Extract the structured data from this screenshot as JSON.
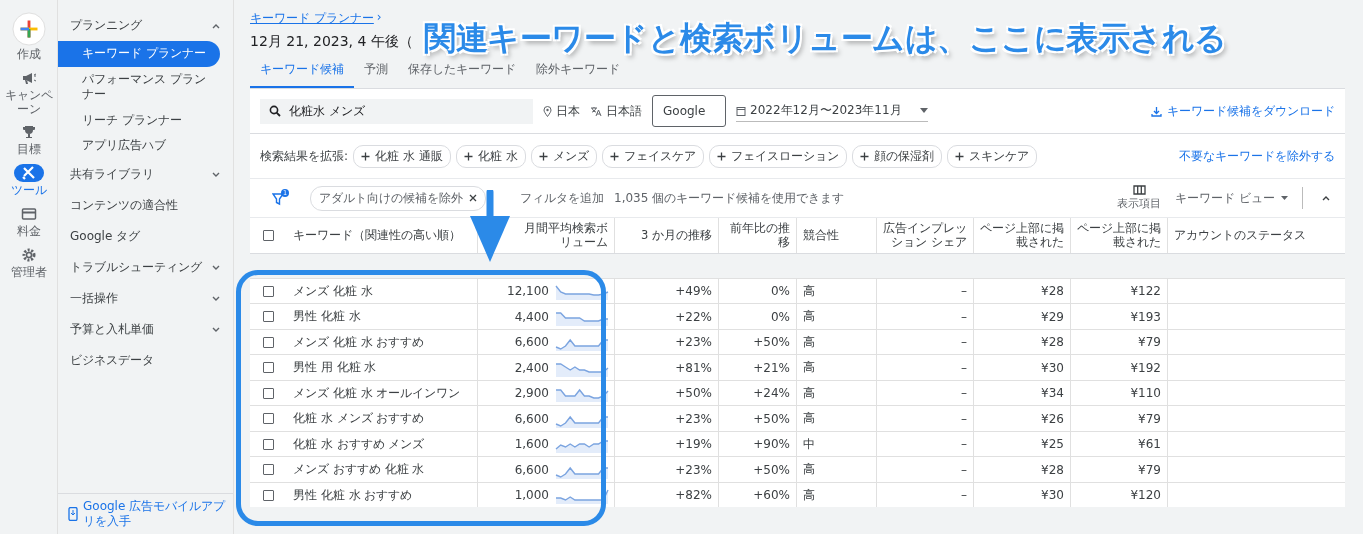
{
  "rail": [
    {
      "kind": "create",
      "label": "作成",
      "selected": false
    },
    {
      "kind": "campaign",
      "label": "キャンペーン",
      "selected": false
    },
    {
      "kind": "goal",
      "label": "目標",
      "selected": false
    },
    {
      "kind": "tools",
      "label": "ツール",
      "selected": true
    },
    {
      "kind": "billing",
      "label": "料金",
      "selected": false
    },
    {
      "kind": "admin",
      "label": "管理者",
      "selected": false
    }
  ],
  "nav": {
    "items": [
      {
        "kind": "group",
        "label": "プランニング",
        "expanded": true,
        "children": [
          {
            "label": "キーワード プランナー",
            "selected": true
          },
          {
            "label": "パフォーマンス プランナー",
            "selected": false
          },
          {
            "label": "リーチ プランナー",
            "selected": false
          },
          {
            "label": "アプリ広告ハブ",
            "selected": false
          }
        ]
      },
      {
        "kind": "group",
        "label": "共有ライブラリ",
        "expanded": false
      },
      {
        "kind": "link",
        "label": "コンテンツの適合性"
      },
      {
        "kind": "link",
        "label": "Google タグ"
      },
      {
        "kind": "group",
        "label": "トラブルシューティング",
        "expanded": false
      },
      {
        "kind": "group",
        "label": "一括操作",
        "expanded": false
      },
      {
        "kind": "group",
        "label": "予算と入札単価",
        "expanded": false
      },
      {
        "kind": "link",
        "label": "ビジネスデータ"
      }
    ],
    "footer": "Google 広告モバイルアプリを入手"
  },
  "breadcrumb": "キーワード プランナー",
  "breadcrumb_separator": "›",
  "title": "12月 21, 2023, 4 午後（",
  "tabs": [
    {
      "label": "キーワード候補",
      "selected": true
    },
    {
      "label": "予測",
      "selected": false
    },
    {
      "label": "保存したキーワード",
      "selected": false
    },
    {
      "label": "除外キーワード",
      "selected": false
    }
  ],
  "search": {
    "value": "化粧水 メンズ",
    "location": "日本",
    "language": "日本語",
    "network": "Google",
    "date_range": "2022年12月〜2023年11月",
    "download": "キーワード候補をダウンロード"
  },
  "expand": {
    "label": "検索結果を拡張:",
    "chips": [
      "化粧 水 通販",
      "化粧 水",
      "メンズ",
      "フェイスケア",
      "フェイスローション",
      "顔の保湿剤",
      "スキンケア"
    ],
    "exclude": "不要なキーワードを除外する"
  },
  "filters": {
    "badge": "1",
    "chip": "アダルト向けの候補を除外",
    "add": "フィルタを追加",
    "count": "1,035 個のキーワード候補を使用できます",
    "columns": "表示項目",
    "view": "キーワード ビュー"
  },
  "table": {
    "select_all_checked": false,
    "columns": [
      "キーワード（関連性の高い順）",
      "月間平均検索ボリューム",
      "3 か月の推移",
      "前年比の推移",
      "競合性",
      "広告インプレッション シェア",
      "ページ上部に掲載された",
      "ページ上部に掲載された",
      "アカウントのステータス"
    ],
    "rows": [
      {
        "checked": false,
        "cells": [
          "メンズ 化粧 水",
          "12,100",
          "+49%",
          "0%",
          "高",
          "–",
          "¥28",
          "¥122",
          ""
        ]
      },
      {
        "checked": false,
        "cells": [
          "男性 化粧 水",
          "4,400",
          "+22%",
          "0%",
          "高",
          "–",
          "¥29",
          "¥193",
          ""
        ]
      },
      {
        "checked": false,
        "cells": [
          "メンズ 化粧 水 おすすめ",
          "6,600",
          "+23%",
          "+50%",
          "高",
          "–",
          "¥28",
          "¥79",
          ""
        ]
      },
      {
        "checked": false,
        "cells": [
          "男性 用 化粧 水",
          "2,400",
          "+81%",
          "+21%",
          "高",
          "–",
          "¥30",
          "¥192",
          ""
        ]
      },
      {
        "checked": false,
        "cells": [
          "メンズ 化粧 水 オールインワン",
          "2,900",
          "+50%",
          "+24%",
          "高",
          "–",
          "¥34",
          "¥110",
          ""
        ]
      },
      {
        "checked": false,
        "cells": [
          "化粧 水 メンズ おすすめ",
          "6,600",
          "+23%",
          "+50%",
          "高",
          "–",
          "¥26",
          "¥79",
          ""
        ]
      },
      {
        "checked": false,
        "cells": [
          "化粧 水 おすすめ メンズ",
          "1,600",
          "+19%",
          "+90%",
          "中",
          "–",
          "¥25",
          "¥61",
          ""
        ]
      },
      {
        "checked": false,
        "cells": [
          "メンズ おすすめ 化粧 水",
          "6,600",
          "+23%",
          "+50%",
          "高",
          "–",
          "¥28",
          "¥79",
          ""
        ]
      },
      {
        "checked": false,
        "cells": [
          "男性 化粧 水 おすすめ",
          "1,000",
          "+82%",
          "+60%",
          "高",
          "–",
          "¥30",
          "¥120",
          ""
        ]
      }
    ]
  },
  "annotation": {
    "text": "関連キーワードと検索ボリュームは、ここに表示される"
  }
}
